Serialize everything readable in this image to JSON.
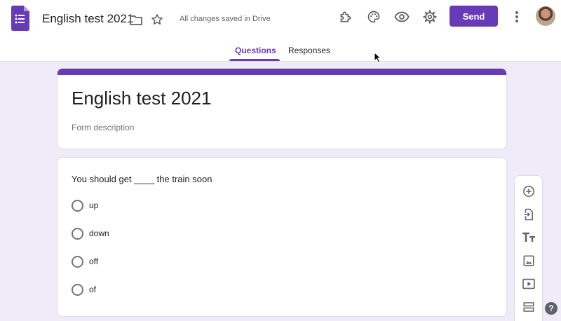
{
  "header": {
    "doc_title": "English test 2021",
    "saved_status": "All changes saved in Drive",
    "send_label": "Send",
    "icons": [
      "forms-logo-icon",
      "folder-icon",
      "star-icon",
      "addon-puzzle-icon",
      "palette-icon",
      "preview-eye-icon",
      "settings-gear-icon",
      "more-vert-icon",
      "avatar"
    ]
  },
  "tabs": [
    {
      "label": "Questions",
      "active": true
    },
    {
      "label": "Responses",
      "active": false
    }
  ],
  "form": {
    "title": "English test 2021",
    "description_placeholder": "Form description"
  },
  "question": {
    "title": "You should get ____ the train soon",
    "options": [
      "up",
      "down",
      "off",
      "of"
    ]
  },
  "side_toolbar": [
    "add-question-icon",
    "import-questions-icon",
    "add-title-text-icon",
    "add-image-icon",
    "add-video-icon",
    "add-section-icon"
  ],
  "help_label": "?",
  "colors": {
    "accent": "#673ab7",
    "background": "#f0ebf8",
    "icon": "#5f6368"
  }
}
